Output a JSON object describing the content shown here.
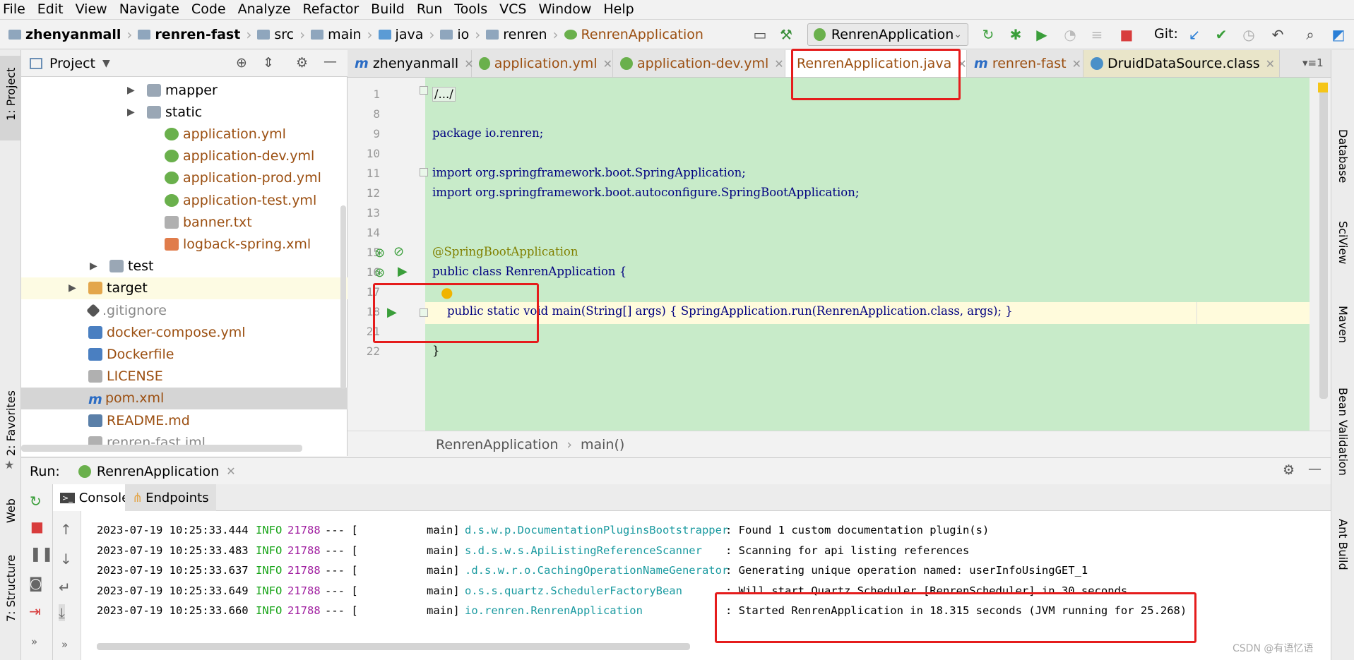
{
  "menu": [
    "File",
    "Edit",
    "View",
    "Navigate",
    "Code",
    "Analyze",
    "Refactor",
    "Build",
    "Run",
    "Tools",
    "VCS",
    "Window",
    "Help"
  ],
  "breadcrumbs": [
    "zhenyanmall",
    "renren-fast",
    "src",
    "main",
    "java",
    "io",
    "renren",
    "RenrenApplication"
  ],
  "run_config": "RenrenApplication",
  "git_label": "Git:",
  "project_panel": {
    "title": "Project",
    "tree": [
      {
        "label": "mapper",
        "type": "folder",
        "arrow": "▶"
      },
      {
        "label": "static",
        "type": "folder",
        "arrow": "▶"
      },
      {
        "label": "application.yml",
        "type": "spring"
      },
      {
        "label": "application-dev.yml",
        "type": "spring"
      },
      {
        "label": "application-prod.yml",
        "type": "spring"
      },
      {
        "label": "application-test.yml",
        "type": "spring"
      },
      {
        "label": "banner.txt",
        "type": "file"
      },
      {
        "label": "logback-spring.xml",
        "type": "xml"
      },
      {
        "label": "test",
        "type": "folder",
        "arrow": "▶"
      },
      {
        "label": "target",
        "type": "folder-orange",
        "arrow": "▶"
      },
      {
        "label": ".gitignore",
        "type": "git"
      },
      {
        "label": "docker-compose.yml",
        "type": "blue"
      },
      {
        "label": "Dockerfile",
        "type": "blue"
      },
      {
        "label": "LICENSE",
        "type": "file"
      },
      {
        "label": "pom.xml",
        "type": "maven"
      },
      {
        "label": "README.md",
        "type": "md"
      },
      {
        "label": "renren-fast.iml",
        "type": "file"
      }
    ]
  },
  "editor_tabs": [
    {
      "label": "zhenyanmall"
    },
    {
      "label": "application.yml"
    },
    {
      "label": "application-dev.yml"
    },
    {
      "label": "RenrenApplication.java",
      "active": true
    },
    {
      "label": "renren-fast"
    },
    {
      "label": "DruidDataSource.class"
    }
  ],
  "tab_overflow": "1",
  "code_lines": [
    {
      "num": "1",
      "text": "/.../"
    },
    {
      "num": "8",
      "text": ""
    },
    {
      "num": "9",
      "text": "package io.renren;"
    },
    {
      "num": "10",
      "text": ""
    },
    {
      "num": "11",
      "text": "import org.springframework.boot.SpringApplication;"
    },
    {
      "num": "12",
      "text": "import org.springframework.boot.autoconfigure.SpringBootApplication;"
    },
    {
      "num": "13",
      "text": ""
    },
    {
      "num": "14",
      "text": ""
    },
    {
      "num": "15",
      "text": "@SpringBootApplication"
    },
    {
      "num": "16",
      "text": "public class RenrenApplication {"
    },
    {
      "num": "17",
      "text": ""
    },
    {
      "num": "18",
      "text": "    public static void main(String[] args) { SpringApplication.run(RenrenApplication.class, args); }"
    },
    {
      "num": "21",
      "text": ""
    },
    {
      "num": "22",
      "text": "}"
    }
  ],
  "editor_breadcrumb": [
    "RenrenApplication",
    "main()"
  ],
  "left_strip": [
    "1: Project",
    "2: Favorites",
    "Web",
    "7: Structure"
  ],
  "right_strip": [
    "Database",
    "SciView",
    "Maven",
    "Bean Validation",
    "Ant Build"
  ],
  "run_panel": {
    "label": "Run:",
    "config": "RenrenApplication",
    "tabs": [
      "Console",
      "Endpoints"
    ]
  },
  "log_lines": [
    {
      "date": "2023-07-19 10:25:33.444",
      "level": "INFO",
      "pid": "21788",
      "sep": "--- [",
      "thread": "main]",
      "logger": "d.s.w.p.DocumentationPluginsBootstrapper",
      "msg": ": Found 1 custom documentation plugin(s)"
    },
    {
      "date": "2023-07-19 10:25:33.483",
      "level": "INFO",
      "pid": "21788",
      "sep": "--- [",
      "thread": "main]",
      "logger": "s.d.s.w.s.ApiListingReferenceScanner",
      "msg": ": Scanning for api listing references"
    },
    {
      "date": "2023-07-19 10:25:33.637",
      "level": "INFO",
      "pid": "21788",
      "sep": "--- [",
      "thread": "main]",
      "logger": ".d.s.w.r.o.CachingOperationNameGenerator",
      "msg": ": Generating unique operation named: userInfoUsingGET_1"
    },
    {
      "date": "2023-07-19 10:25:33.649",
      "level": "INFO",
      "pid": "21788",
      "sep": "--- [",
      "thread": "main]",
      "logger": "o.s.s.quartz.SchedulerFactoryBean",
      "msg": ": Will start Quartz Scheduler [RenrenScheduler] in 30 seconds"
    },
    {
      "date": "2023-07-19 10:25:33.660",
      "level": "INFO",
      "pid": "21788",
      "sep": "--- [",
      "thread": "main]",
      "logger": "io.renren.RenrenApplication",
      "msg": ": Started RenrenApplication in 18.315 seconds (JVM running for 25.268)"
    }
  ],
  "watermark": "CSDN @有语忆语"
}
